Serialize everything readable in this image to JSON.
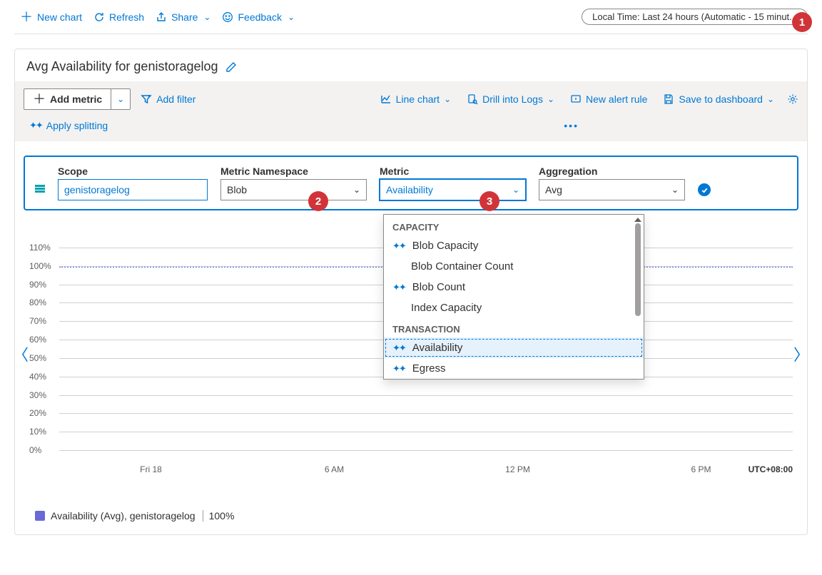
{
  "toolbar": {
    "new_chart": "New chart",
    "refresh": "Refresh",
    "share": "Share",
    "feedback": "Feedback",
    "time_range": "Local Time: Last 24 hours (Automatic - 15 minut..."
  },
  "callouts": {
    "one": "1",
    "two": "2",
    "three": "3"
  },
  "panel": {
    "title": "Avg Availability for genistoragelog",
    "add_metric": "Add metric",
    "add_filter": "Add filter",
    "line_chart": "Line chart",
    "drill_logs": "Drill into Logs",
    "new_alert": "New alert rule",
    "save_dash": "Save to dashboard",
    "apply_split": "Apply splitting"
  },
  "config": {
    "scope_label": "Scope",
    "scope_value": "genistoragelog",
    "ns_label": "Metric Namespace",
    "ns_value": "Blob",
    "metric_label": "Metric",
    "metric_value": "Availability",
    "agg_label": "Aggregation",
    "agg_value": "Avg"
  },
  "dropdown": {
    "group1": "CAPACITY",
    "items1": [
      "Blob Capacity",
      "Blob Container Count",
      "Blob Count",
      "Index Capacity"
    ],
    "group2": "TRANSACTION",
    "items2": [
      "Availability",
      "Egress"
    ]
  },
  "legend": {
    "text": "Availability (Avg), genistoragelog",
    "value": "100%"
  },
  "utc": "UTC+08:00",
  "chart_data": {
    "type": "line",
    "title": "Avg Availability for genistoragelog",
    "xlabel": "",
    "ylabel": "",
    "ylim": [
      0,
      110
    ],
    "y_ticks": [
      "110%",
      "100%",
      "90%",
      "80%",
      "70%",
      "60%",
      "50%",
      "40%",
      "30%",
      "20%",
      "10%",
      "0%"
    ],
    "x_ticks": [
      "Fri 18",
      "6 AM",
      "12 PM",
      "6 PM"
    ],
    "series": [
      {
        "name": "Availability (Avg), genistoragelog",
        "x": [
          "Fri 18",
          "6 AM",
          "12 PM",
          "6 PM"
        ],
        "values": [
          100,
          100,
          100,
          100
        ]
      }
    ]
  }
}
